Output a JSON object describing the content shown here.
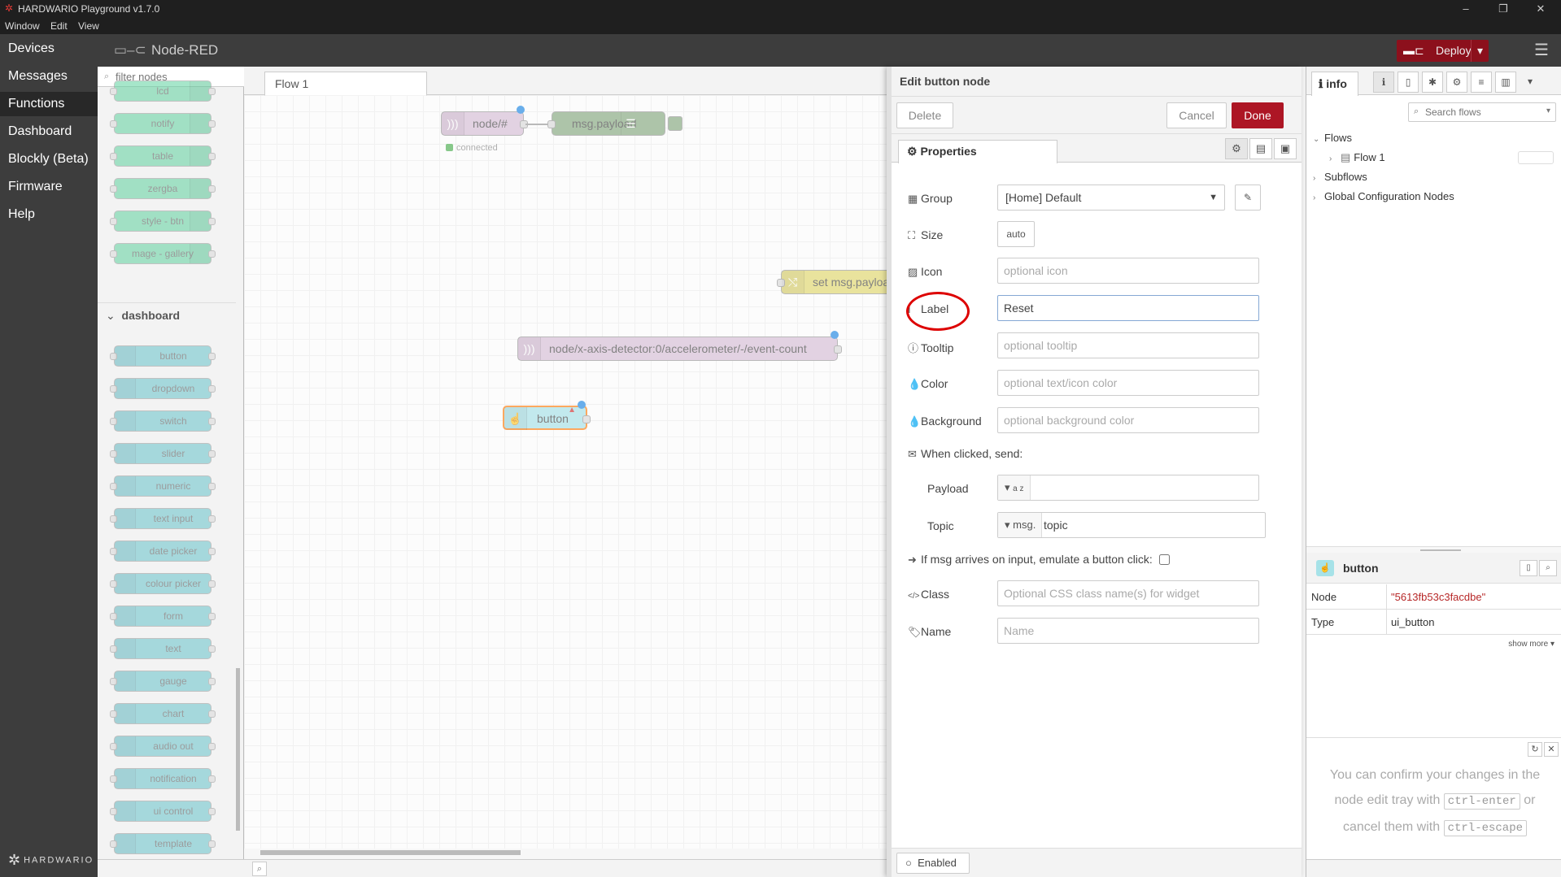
{
  "window": {
    "title": "HARDWARIO Playground v1.7.0",
    "menu": [
      "Window",
      "Edit",
      "View"
    ],
    "controls": {
      "minimize": "–",
      "maximize": "❐",
      "close": "✕"
    }
  },
  "app_nav": {
    "items": [
      "Devices",
      "Messages",
      "Functions",
      "Dashboard",
      "Blockly (Beta)",
      "Firmware",
      "Help"
    ],
    "active": "Functions",
    "logo": "HARDWARIO"
  },
  "header": {
    "brand": "Node-RED",
    "deploy_label": "Deploy"
  },
  "palette": {
    "filter_placeholder": "filter nodes",
    "top_nodes": [
      {
        "label": "lcd",
        "color": "#5fd29f"
      },
      {
        "label": "notify",
        "color": "#5fd29f"
      },
      {
        "label": "table",
        "color": "#5fd29f"
      },
      {
        "label": "zergba",
        "color": "#5fd29f"
      },
      {
        "label": "style - btn",
        "color": "#5fd29f"
      },
      {
        "label": "mage - gallery",
        "color": "#5fd29f"
      }
    ],
    "category": "dashboard",
    "dashboard_nodes": [
      "button",
      "dropdown",
      "switch",
      "slider",
      "numeric",
      "text input",
      "date picker",
      "colour picker",
      "form",
      "text",
      "gauge",
      "chart",
      "audio out",
      "notification",
      "ui control",
      "template"
    ],
    "dashboard_color": "#67c2cb"
  },
  "workspace": {
    "tab": "Flow 1",
    "nodes": {
      "mqtt_in": "node/#",
      "mqtt_status": "connected",
      "debug": "msg.payload",
      "change": "set msg.payloa",
      "detector": "node/x-axis-detector:0/accelerometer/-/event-count",
      "button": "button"
    }
  },
  "tray": {
    "title": "Edit button node",
    "delete_label": "Delete",
    "cancel_label": "Cancel",
    "done_label": "Done",
    "tab_properties": "Properties",
    "fields": {
      "group_label": "Group",
      "group_value": "[Home] Default",
      "size_label": "Size",
      "size_value": "auto",
      "icon_label": "Icon",
      "icon_placeholder": "optional icon",
      "label_label": "Label",
      "label_value": "Reset",
      "tooltip_label": "Tooltip",
      "tooltip_placeholder": "optional tooltip",
      "color_label": "Color",
      "color_placeholder": "optional text/icon color",
      "background_label": "Background",
      "background_placeholder": "optional background color",
      "when_clicked": "When clicked, send:",
      "payload_label": "Payload",
      "payload_type": "a z",
      "payload_value": "",
      "topic_label": "Topic",
      "topic_type": "msg.",
      "topic_value": "topic",
      "emulate_label": "If msg arrives on input, emulate a button click:",
      "class_label": "Class",
      "class_placeholder": "Optional CSS class name(s) for widget",
      "name_label": "Name",
      "name_placeholder": "Name"
    },
    "enabled_label": "Enabled"
  },
  "sidebar": {
    "tab_label": "info",
    "search_placeholder": "Search flows",
    "tree": {
      "flows": "Flows",
      "flow1": "Flow 1",
      "subflows": "Subflows",
      "global": "Global Configuration Nodes"
    },
    "node_title": "button",
    "props": [
      {
        "key": "Node",
        "value": "\"5613fb53c3facdbe\""
      },
      {
        "key": "Type",
        "value": "ui_button"
      }
    ],
    "show_more": "show more ▾",
    "help": {
      "line1": "You can confirm your changes in the node edit tray with",
      "key1": "ctrl-enter",
      "or": "or",
      "line2": "cancel them with",
      "key2": "ctrl-escape"
    }
  }
}
